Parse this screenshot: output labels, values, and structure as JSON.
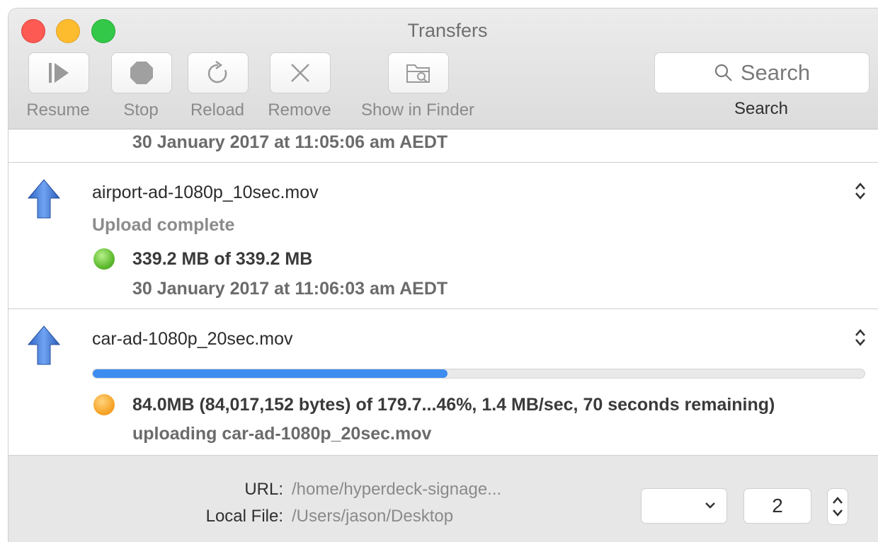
{
  "window": {
    "title": "Transfers"
  },
  "toolbar": {
    "resume_label": "Resume",
    "stop_label": "Stop",
    "reload_label": "Reload",
    "remove_label": "Remove",
    "finder_label": "Show in Finder",
    "search_placeholder": "Search",
    "search_label": "Search"
  },
  "transfers": [
    {
      "timestamp": "30 January 2017 at 11:05:06 am AEDT"
    },
    {
      "filename": "airport-ad-1080p_10sec.mov",
      "status": "Upload complete",
      "size_text": "339.2 MB of 339.2 MB",
      "timestamp": "30 January 2017 at 11:06:03 am AEDT",
      "dot_color": "#5fbb2f",
      "icon": "upload-arrow-icon"
    },
    {
      "filename": "car-ad-1080p_20sec.mov",
      "progress_fraction": 0.46,
      "progress_text": "84.0MB (84,017,152 bytes) of 179.7...46%, 1.4 MB/sec, 70 seconds remaining)",
      "status": "uploading car-ad-1080p_20sec.mov",
      "dot_color": "#f7a62a",
      "icon": "upload-arrow-icon"
    }
  ],
  "footer": {
    "url_label": "URL:",
    "url_value": "/home/hyperdeck-signage...",
    "local_file_label": "Local File:",
    "local_file_value": "/Users/jason/Desktop",
    "connections_value": "2"
  },
  "colors": {
    "accent": "#3d8df0",
    "complete": "#5fbb2f",
    "in_progress": "#f7a62a"
  }
}
